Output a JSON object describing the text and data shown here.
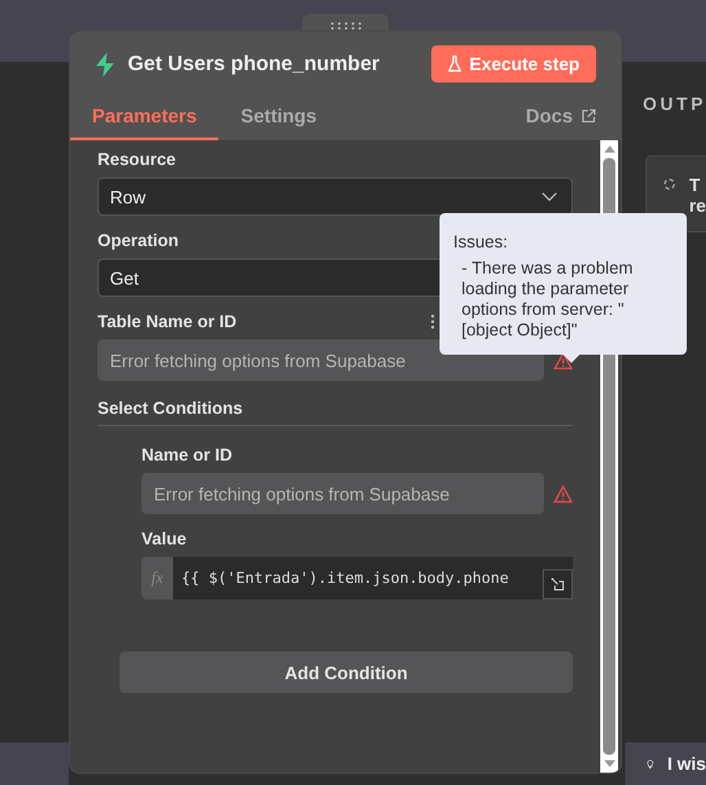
{
  "panel": {
    "title": "Get Users phone_number",
    "execute_button": "Execute step",
    "docs_link": "Docs",
    "tabs": [
      {
        "label": "Parameters",
        "selected": true
      },
      {
        "label": "Settings",
        "selected": false
      }
    ]
  },
  "fields": [
    {
      "kind": "select",
      "label": "Resource",
      "value": "Row"
    },
    {
      "kind": "select",
      "label": "Operation",
      "value": "Get"
    },
    {
      "kind": "error",
      "label": "Table Name or ID",
      "placeholder": "Error fetching options from Supabase"
    }
  ],
  "conditions": {
    "title": "Select Conditions",
    "fields": [
      {
        "kind": "error",
        "label": "Name or ID",
        "placeholder": "Error fetching options from Supabase"
      },
      {
        "kind": "expression",
        "label": "Value",
        "fx_label": "fx",
        "value": "{{ $('Entrada').item.json.body.phone"
      }
    ],
    "add_button": "Add Condition"
  },
  "tooltip": {
    "title": "Issues:",
    "message": "- There was a problem loading the parameter options from server: \"[object Object]\""
  },
  "output": {
    "heading": "OUTP",
    "card_lines": [
      "T",
      "re"
    ]
  },
  "hint_bar": {
    "text": "I wis"
  }
}
